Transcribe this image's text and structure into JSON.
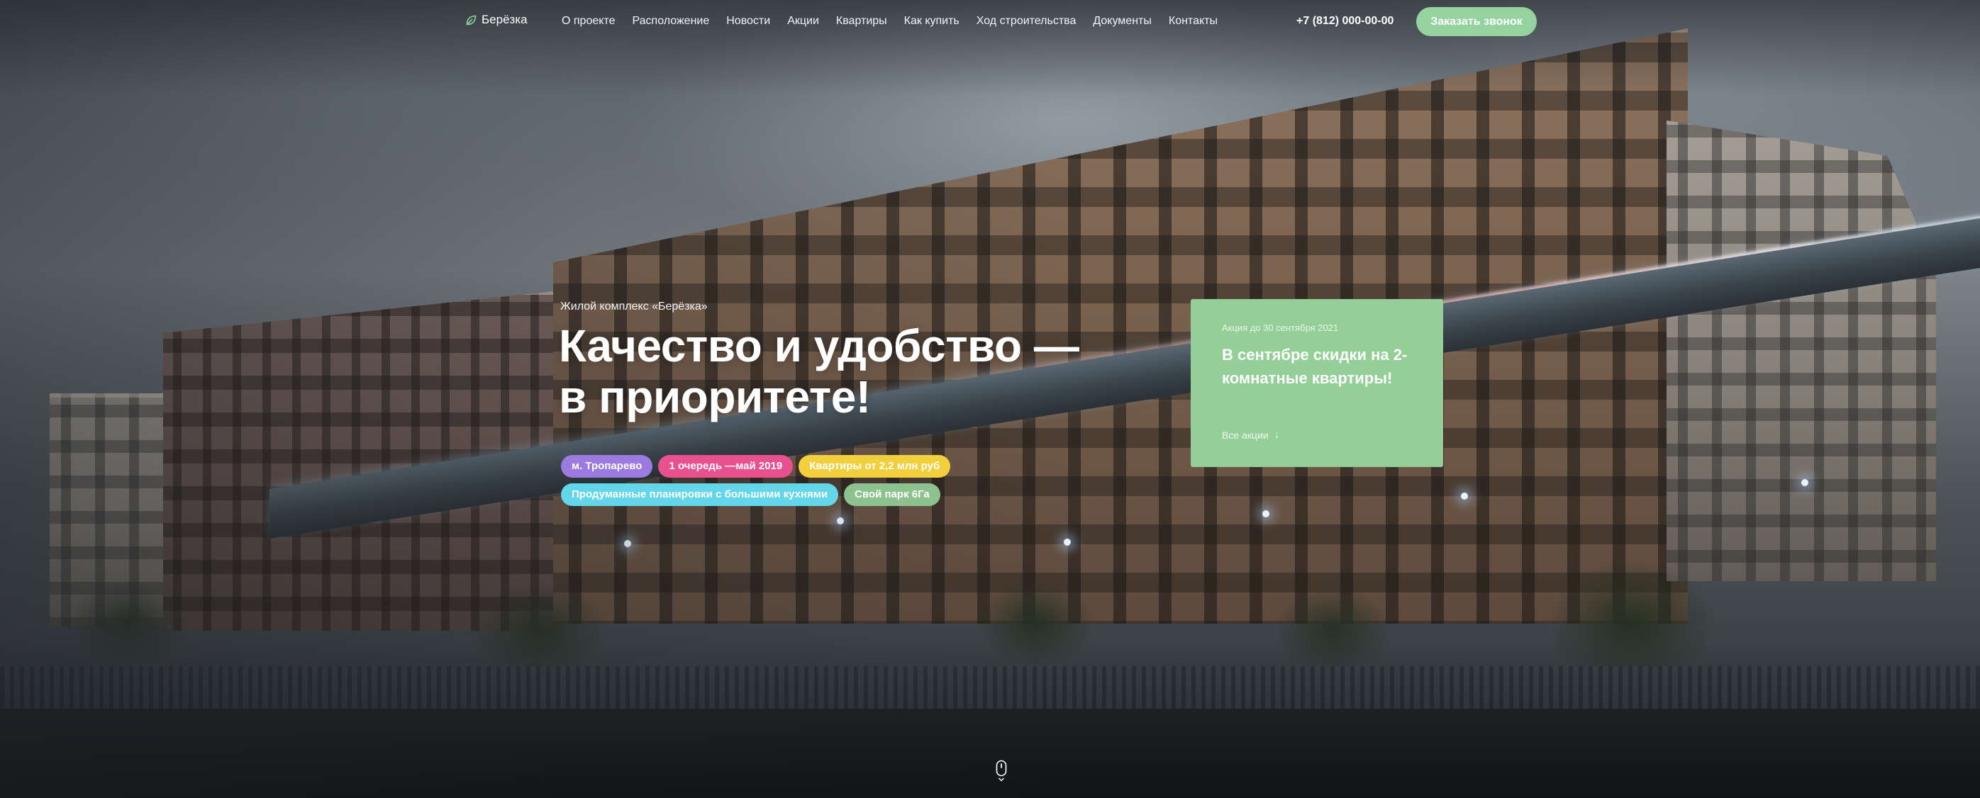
{
  "header": {
    "logo_text": "Берёзка",
    "nav": [
      "О проекте",
      "Расположение",
      "Новости",
      "Акции",
      "Квартиры",
      "Как купить",
      "Ход строительства",
      "Документы",
      "Контакты"
    ],
    "phone": "+7 (812) 000-00-00",
    "call_button": "Заказать звонок"
  },
  "hero": {
    "eyebrow": "Жилой комплекс «Берёзка»",
    "headline_line1": "Качество и удобство —",
    "headline_line2": "в приоритете!",
    "tags": [
      {
        "label": "м. Тропарево",
        "color": "#9b7be0"
      },
      {
        "label": "1 очередь —май 2019",
        "color": "#e8508e"
      },
      {
        "label": "Квартиры от 2,2 млн руб",
        "color": "#f2cf3d"
      },
      {
        "label": "Продуманные планировки с большими кухнями",
        "color": "#64d6ea"
      },
      {
        "label": "Свой парк 6Га",
        "color": "#8dc28f"
      }
    ]
  },
  "promo": {
    "date": "Акция до 30 сентября 2021",
    "title": "В сентябре скидки на 2-комнатные квартиры!",
    "link": "Все акции"
  },
  "colors": {
    "accent_green": "#94d3a0",
    "promo_green": "#94cf98"
  }
}
